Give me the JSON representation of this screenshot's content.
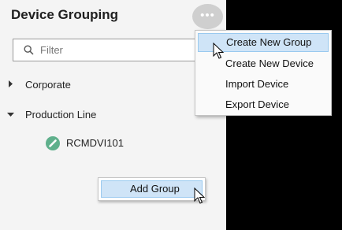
{
  "panel": {
    "title": "Device Grouping",
    "more_button": "•••"
  },
  "filter": {
    "placeholder": "Filter",
    "value": ""
  },
  "tree": {
    "groups": [
      {
        "label": "Corporate",
        "expanded": false
      },
      {
        "label": "Production Line",
        "expanded": true
      }
    ],
    "devices": [
      {
        "label": "RCMDVI101",
        "status": "online",
        "status_color": "#5fb08c"
      }
    ]
  },
  "context_menu": {
    "items": [
      {
        "label": "Add Group",
        "highlighted": true
      }
    ]
  },
  "dropdown_menu": {
    "items": [
      {
        "label": "Create New Group",
        "highlighted": true
      },
      {
        "label": "Create New Device",
        "highlighted": false
      },
      {
        "label": "Import Device",
        "highlighted": false
      },
      {
        "label": "Export Device",
        "highlighted": false
      }
    ]
  },
  "colors": {
    "highlight": "#cfe4f7",
    "highlight_border": "#99c9ef",
    "status_online": "#5fb08c"
  }
}
